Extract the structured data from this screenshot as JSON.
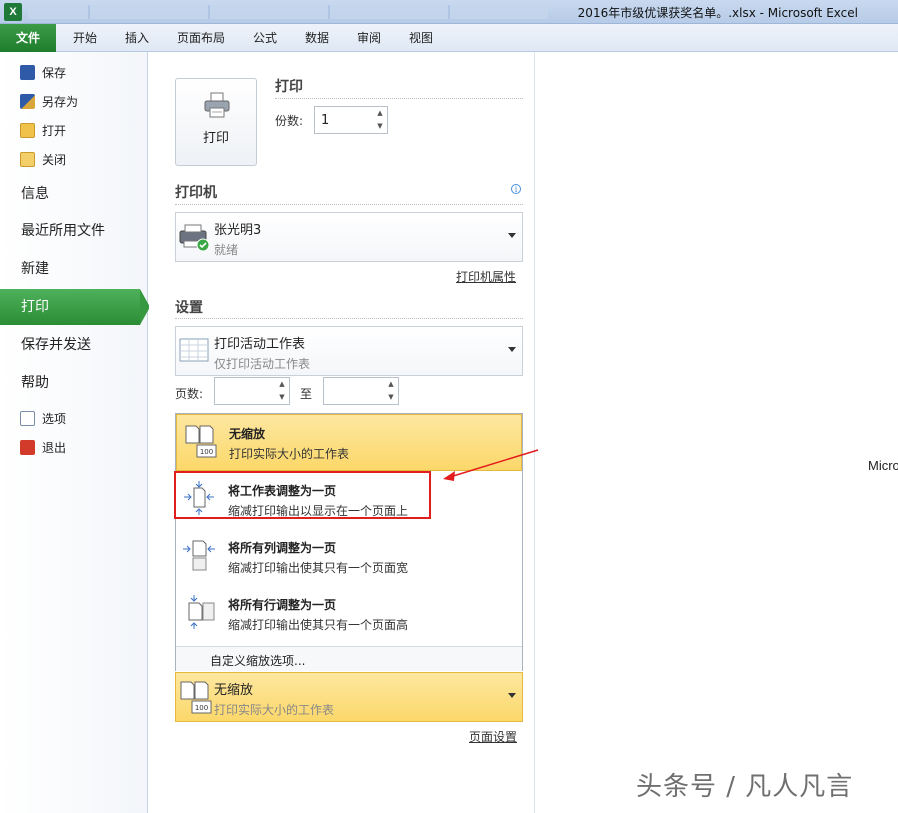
{
  "window": {
    "app_icon": "X",
    "title": "2016年市级优课获奖名单。.xlsx - Microsoft Excel"
  },
  "ribbon_tabs": [
    "文件",
    "开始",
    "插入",
    "页面布局",
    "公式",
    "数据",
    "审阅",
    "视图"
  ],
  "nav": {
    "small_items": [
      {
        "label": "保存",
        "icon": "save-icon"
      },
      {
        "label": "另存为",
        "icon": "save-as-icon"
      },
      {
        "label": "打开",
        "icon": "open-folder-icon"
      },
      {
        "label": "关闭",
        "icon": "close-folder-icon"
      }
    ],
    "big_items": [
      "信息",
      "最近所用文件",
      "新建",
      "打印",
      "保存并发送",
      "帮助"
    ],
    "bottom_items": [
      {
        "label": "选项",
        "icon": "options-icon"
      },
      {
        "label": "退出",
        "icon": "exit-icon"
      }
    ],
    "active": "打印"
  },
  "print": {
    "button_label": "打印",
    "heading": "打印",
    "copies_label": "份数:",
    "copies_value": "1"
  },
  "printer": {
    "heading": "打印机",
    "name": "张光明3",
    "status": "就绪",
    "properties_link": "打印机属性"
  },
  "settings": {
    "heading": "设置",
    "print_what_main": "打印活动工作表",
    "print_what_sub": "仅打印活动工作表",
    "pages_label": "页数:",
    "to_label": "至",
    "scaling_options": [
      {
        "main": "无缩放",
        "sub": "打印实际大小的工作表",
        "icon": "no-scaling-icon"
      },
      {
        "main": "将工作表调整为一页",
        "sub": "缩减打印输出以显示在一个页面上",
        "icon": "fit-sheet-icon"
      },
      {
        "main": "将所有列调整为一页",
        "sub": "缩减打印输出使其只有一个页面宽",
        "icon": "fit-columns-icon"
      },
      {
        "main": "将所有行调整为一页",
        "sub": "缩减打印输出使其只有一个页面高",
        "icon": "fit-rows-icon"
      }
    ],
    "custom_scaling": "自定义缩放选项...",
    "scaling_selected_main": "无缩放",
    "scaling_selected_sub": "打印实际大小的工作表",
    "page_setup_link": "页面设置"
  },
  "preview": {
    "text": "Micro"
  },
  "watermark": "头条号 / 凡人凡言",
  "colors": {
    "accent_green": "#2b8c34",
    "selection_yellow": "#fcd86a",
    "annotation_red": "#e21d1d"
  }
}
